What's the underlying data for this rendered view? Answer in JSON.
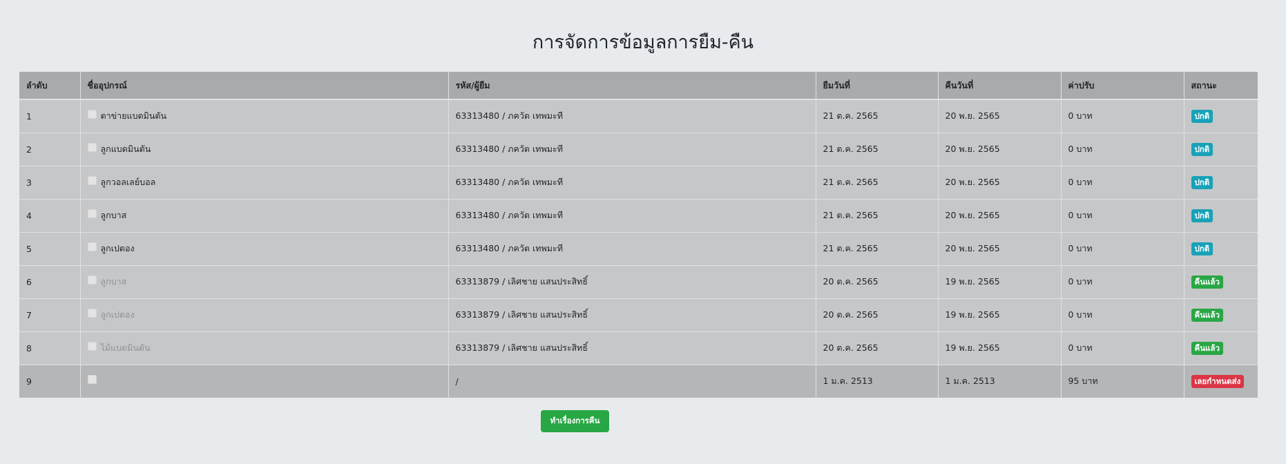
{
  "title": "การจัดการข้อมูลการยืม-คืน",
  "table": {
    "headers": {
      "no": "ลำดับ",
      "name": "ชื่ออุปกรณ์",
      "user": "รหัส/ผู้ยืม",
      "borrow_date": "ยืมวันที่",
      "return_date": "คืนวันที่",
      "fine": "ค่าปรับ",
      "status": "สถานะ"
    },
    "rows": [
      {
        "no": "1",
        "name": "ตาข่ายแบดมินตัน",
        "name_muted": false,
        "user": "63313480 / ภควัต เทพมะที",
        "borrow_date": "21 ต.ค. 2565",
        "return_date": "20 พ.ย. 2565",
        "fine": "0 บาท",
        "status": "ปกติ",
        "status_type": "info"
      },
      {
        "no": "2",
        "name": "ลูกแบดมินตัน",
        "name_muted": false,
        "user": "63313480 / ภควัต เทพมะที",
        "borrow_date": "21 ต.ค. 2565",
        "return_date": "20 พ.ย. 2565",
        "fine": "0 บาท",
        "status": "ปกติ",
        "status_type": "info"
      },
      {
        "no": "3",
        "name": "ลูกวอลเลย์บอล",
        "name_muted": false,
        "user": "63313480 / ภควัต เทพมะที",
        "borrow_date": "21 ต.ค. 2565",
        "return_date": "20 พ.ย. 2565",
        "fine": "0 บาท",
        "status": "ปกติ",
        "status_type": "info"
      },
      {
        "no": "4",
        "name": "ลูกบาส",
        "name_muted": false,
        "user": "63313480 / ภควัต เทพมะที",
        "borrow_date": "21 ต.ค. 2565",
        "return_date": "20 พ.ย. 2565",
        "fine": "0 บาท",
        "status": "ปกติ",
        "status_type": "info"
      },
      {
        "no": "5",
        "name": "ลูกเปตอง",
        "name_muted": false,
        "user": "63313480 / ภควัต เทพมะที",
        "borrow_date": "21 ต.ค. 2565",
        "return_date": "20 พ.ย. 2565",
        "fine": "0 บาท",
        "status": "ปกติ",
        "status_type": "info"
      },
      {
        "no": "6",
        "name": "ลูกบาส",
        "name_muted": true,
        "user": "63313879 / เลิศชาย แสนประสิทธิ์",
        "borrow_date": "20 ต.ค. 2565",
        "return_date": "19 พ.ย. 2565",
        "fine": "0 บาท",
        "status": "คืนแล้ว",
        "status_type": "success"
      },
      {
        "no": "7",
        "name": "ลูกเปตอง",
        "name_muted": true,
        "user": "63313879 / เลิศชาย แสนประสิทธิ์",
        "borrow_date": "20 ต.ค. 2565",
        "return_date": "19 พ.ย. 2565",
        "fine": "0 บาท",
        "status": "คืนแล้ว",
        "status_type": "success"
      },
      {
        "no": "8",
        "name": "ไม้แบดมินตัน",
        "name_muted": true,
        "user": "63313879 / เลิศชาย แสนประสิทธิ์",
        "borrow_date": "20 ต.ค. 2565",
        "return_date": "19 พ.ย. 2565",
        "fine": "0 บาท",
        "status": "คืนแล้ว",
        "status_type": "success"
      },
      {
        "no": "9",
        "name": "",
        "name_muted": false,
        "user": "/",
        "borrow_date": "1 ม.ค. 2513",
        "return_date": "1 ม.ค. 2513",
        "fine": "95 บาท",
        "status": "เลยกำหนดส่ง",
        "status_type": "danger"
      }
    ]
  },
  "return_button_label": "ทำเรื่องการคืน",
  "colors": {
    "background": "#e8ebee",
    "header_bg": "#a9aaab",
    "row_bg": "#c6c7c8",
    "badge_info": "#17a2b8",
    "badge_success": "#28a745",
    "badge_danger": "#dc3545",
    "button": "#28a745"
  }
}
